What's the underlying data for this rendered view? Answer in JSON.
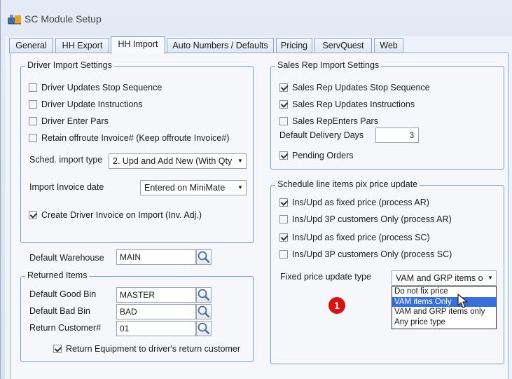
{
  "window": {
    "title": "SC Module Setup"
  },
  "tabs": [
    {
      "label": "General"
    },
    {
      "label": "HH Export"
    },
    {
      "label": "HH Import"
    },
    {
      "label": "Auto Numbers / Defaults"
    },
    {
      "label": "Pricing"
    },
    {
      "label": "ServQuest"
    },
    {
      "label": "Web"
    }
  ],
  "driver_import": {
    "title": "Driver Import Settings",
    "checkboxes": [
      {
        "label": "Driver Updates Stop Sequence",
        "checked": false
      },
      {
        "label": "Driver Update Instructions",
        "checked": false
      },
      {
        "label": "Driver Enter Pars",
        "checked": false
      },
      {
        "label": "Retain offroute Invoice# (Keep offroute Invoice#)",
        "checked": false
      }
    ],
    "sched_label": "Sched. import type",
    "sched_value": "2. Upd and Add New (With Qty",
    "invoice_date_label": "Import Invoice date",
    "invoice_date_value": "Entered on MiniMate",
    "create_invoice": {
      "label": "Create Driver Invoice on Import (Inv. Adj.)",
      "checked": true
    }
  },
  "default_warehouse": {
    "label": "Default Warehouse",
    "value": "MAIN"
  },
  "returned_items": {
    "title": "Returned Items",
    "good_bin_label": "Default Good Bin",
    "good_bin_value": "MASTER",
    "bad_bin_label": "Default Bad Bin",
    "bad_bin_value": "BAD",
    "customer_label": "Return Customer#",
    "customer_value": "01",
    "return_equipment": {
      "label": "Return Equipment to driver's return customer",
      "checked": true
    }
  },
  "sales_rep": {
    "title": "Sales Rep Import Settings",
    "checkboxes": [
      {
        "label": "Sales Rep Updates Stop Sequence",
        "checked": true
      },
      {
        "label": "Sales Rep Updates Instructions",
        "checked": true
      },
      {
        "label": "Sales RepEnters Pars",
        "checked": false
      }
    ],
    "delivery_days_label": "Default Delivery Days",
    "delivery_days_value": "3",
    "pending_orders": {
      "label": "Pending Orders",
      "checked": true
    }
  },
  "schedule_price": {
    "title": "Schedule line items pix price update",
    "checkboxes": [
      {
        "label": "Ins/Upd as fixed price (process AR)",
        "checked": true
      },
      {
        "label": "Ins/Upd 3P customers Only (process AR)",
        "checked": false
      },
      {
        "label": "Ins/Upd as fixed price (process SC)",
        "checked": true
      },
      {
        "label": "Ins/Upd 3P customers Only (process SC)",
        "checked": false
      }
    ],
    "fixed_type_label": "Fixed price update type",
    "fixed_type_value": "VAM and GRP items o",
    "options": [
      "Do not fix price",
      "VAM items Only",
      "VAM and GRP items only",
      "Any price type"
    ],
    "highlighted_option": 1
  },
  "annotation": {
    "badge": "1",
    "color": "#d51313"
  },
  "colors": {
    "accent": "#3a6fd8",
    "group_border": "#7f9cc4"
  }
}
